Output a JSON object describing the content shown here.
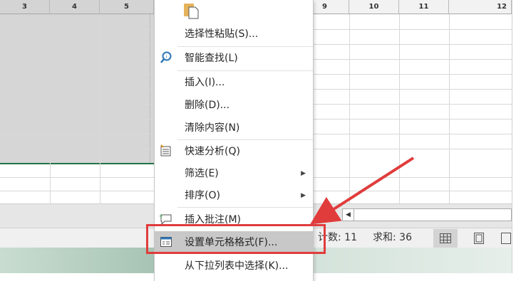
{
  "sheet": {
    "columns_left": [
      "3",
      "4",
      "5"
    ],
    "columns_right": [
      "9",
      "10",
      "11",
      "12"
    ]
  },
  "statusbar": {
    "count_label": "计数: 11",
    "sum_label": "求和: 36"
  },
  "context_menu": {
    "items": [
      {
        "label": "选择性粘贴(S)...",
        "icon": ""
      },
      {
        "label": "智能查找(L)",
        "icon": "smart-lookup-icon"
      },
      {
        "label": "插入(I)...",
        "icon": ""
      },
      {
        "label": "删除(D)...",
        "icon": ""
      },
      {
        "label": "清除内容(N)",
        "icon": ""
      },
      {
        "label": "快速分析(Q)",
        "icon": "quick-analysis-icon"
      },
      {
        "label": "筛选(E)",
        "icon": "",
        "submenu": true
      },
      {
        "label": "排序(O)",
        "icon": "",
        "submenu": true
      },
      {
        "label": "插入批注(M)",
        "icon": "insert-comment-icon"
      },
      {
        "label": "设置单元格格式(F)...",
        "icon": "format-cells-icon",
        "highlighted": true
      },
      {
        "label": "从下拉列表中选择(K)...",
        "icon": ""
      }
    ]
  },
  "colors": {
    "accent_green": "#217346",
    "highlight_red": "#e03c3c",
    "icon_blue": "#2e75b6"
  }
}
